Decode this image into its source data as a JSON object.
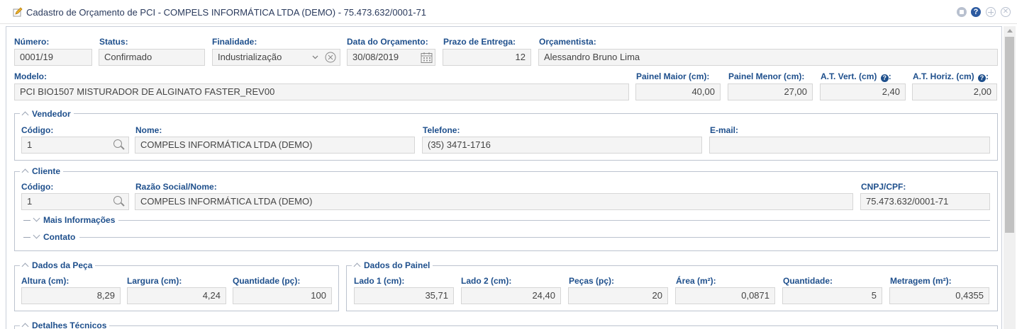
{
  "window": {
    "title": "Cadastro de Orçamento de PCI - COMPELS INFORMÁTICA LTDA (DEMO) - 75.473.632/0001-71",
    "help_glyph": "?",
    "close_glyph": "✕"
  },
  "header": {
    "numero": {
      "label": "Número:",
      "value": "0001/19"
    },
    "status": {
      "label": "Status:",
      "value": "Confirmado"
    },
    "finalidade": {
      "label": "Finalidade:",
      "value": "Industrialização"
    },
    "data": {
      "label": "Data do Orçamento:",
      "value": "30/08/2019"
    },
    "prazo": {
      "label": "Prazo de Entrega:",
      "value": "12"
    },
    "orcamentista": {
      "label": "Orçamentista:",
      "value": "Alessandro Bruno Lima"
    },
    "modelo": {
      "label": "Modelo:",
      "value": "PCI BIO1507 MISTURADOR DE ALGINATO FASTER_REV00"
    },
    "painel_maior": {
      "label": "Painel Maior (cm):",
      "value": "40,00"
    },
    "painel_menor": {
      "label": "Painel Menor (cm):",
      "value": "27,00"
    },
    "at_vert": {
      "label": "A.T. Vert. (cm)",
      "value": "2,40"
    },
    "at_horiz": {
      "label": "A.T. Horiz. (cm)",
      "value": "2,00"
    },
    "help_glyph": "?",
    "colon": ":"
  },
  "vendedor": {
    "legend": "Vendedor",
    "codigo": {
      "label": "Código:",
      "value": "1"
    },
    "nome": {
      "label": "Nome:",
      "value": "COMPELS INFORMÁTICA LTDA (DEMO)"
    },
    "telefone": {
      "label": "Telefone:",
      "value": "(35) 3471-1716"
    },
    "email": {
      "label": "E-mail:",
      "value": ""
    }
  },
  "cliente": {
    "legend": "Cliente",
    "codigo": {
      "label": "Código:",
      "value": "1"
    },
    "razao": {
      "label": "Razão Social/Nome:",
      "value": "COMPELS INFORMÁTICA LTDA (DEMO)"
    },
    "cnpj": {
      "label": "CNPJ/CPF:",
      "value": "75.473.632/0001-71"
    },
    "mais_info": "Mais Informações",
    "contato": "Contato"
  },
  "dados_peca": {
    "legend": "Dados da Peça",
    "altura": {
      "label": "Altura (cm):",
      "value": "8,29"
    },
    "largura": {
      "label": "Largura (cm):",
      "value": "4,24"
    },
    "quantidade": {
      "label": "Quantidade (pç):",
      "value": "100"
    }
  },
  "dados_painel": {
    "legend": "Dados do Painel",
    "lado1": {
      "label": "Lado 1 (cm):",
      "value": "35,71"
    },
    "lado2": {
      "label": "Lado 2 (cm):",
      "value": "24,40"
    },
    "pecas": {
      "label": "Peças (pç):",
      "value": "20"
    },
    "area": {
      "label": "Área (m²):",
      "value": "0,0871"
    },
    "quantidade": {
      "label": "Quantidade:",
      "value": "5"
    },
    "metragem": {
      "label": "Metragem (m²):",
      "value": "0,4355"
    }
  },
  "detalhes": {
    "legend": "Detalhes Técnicos"
  }
}
